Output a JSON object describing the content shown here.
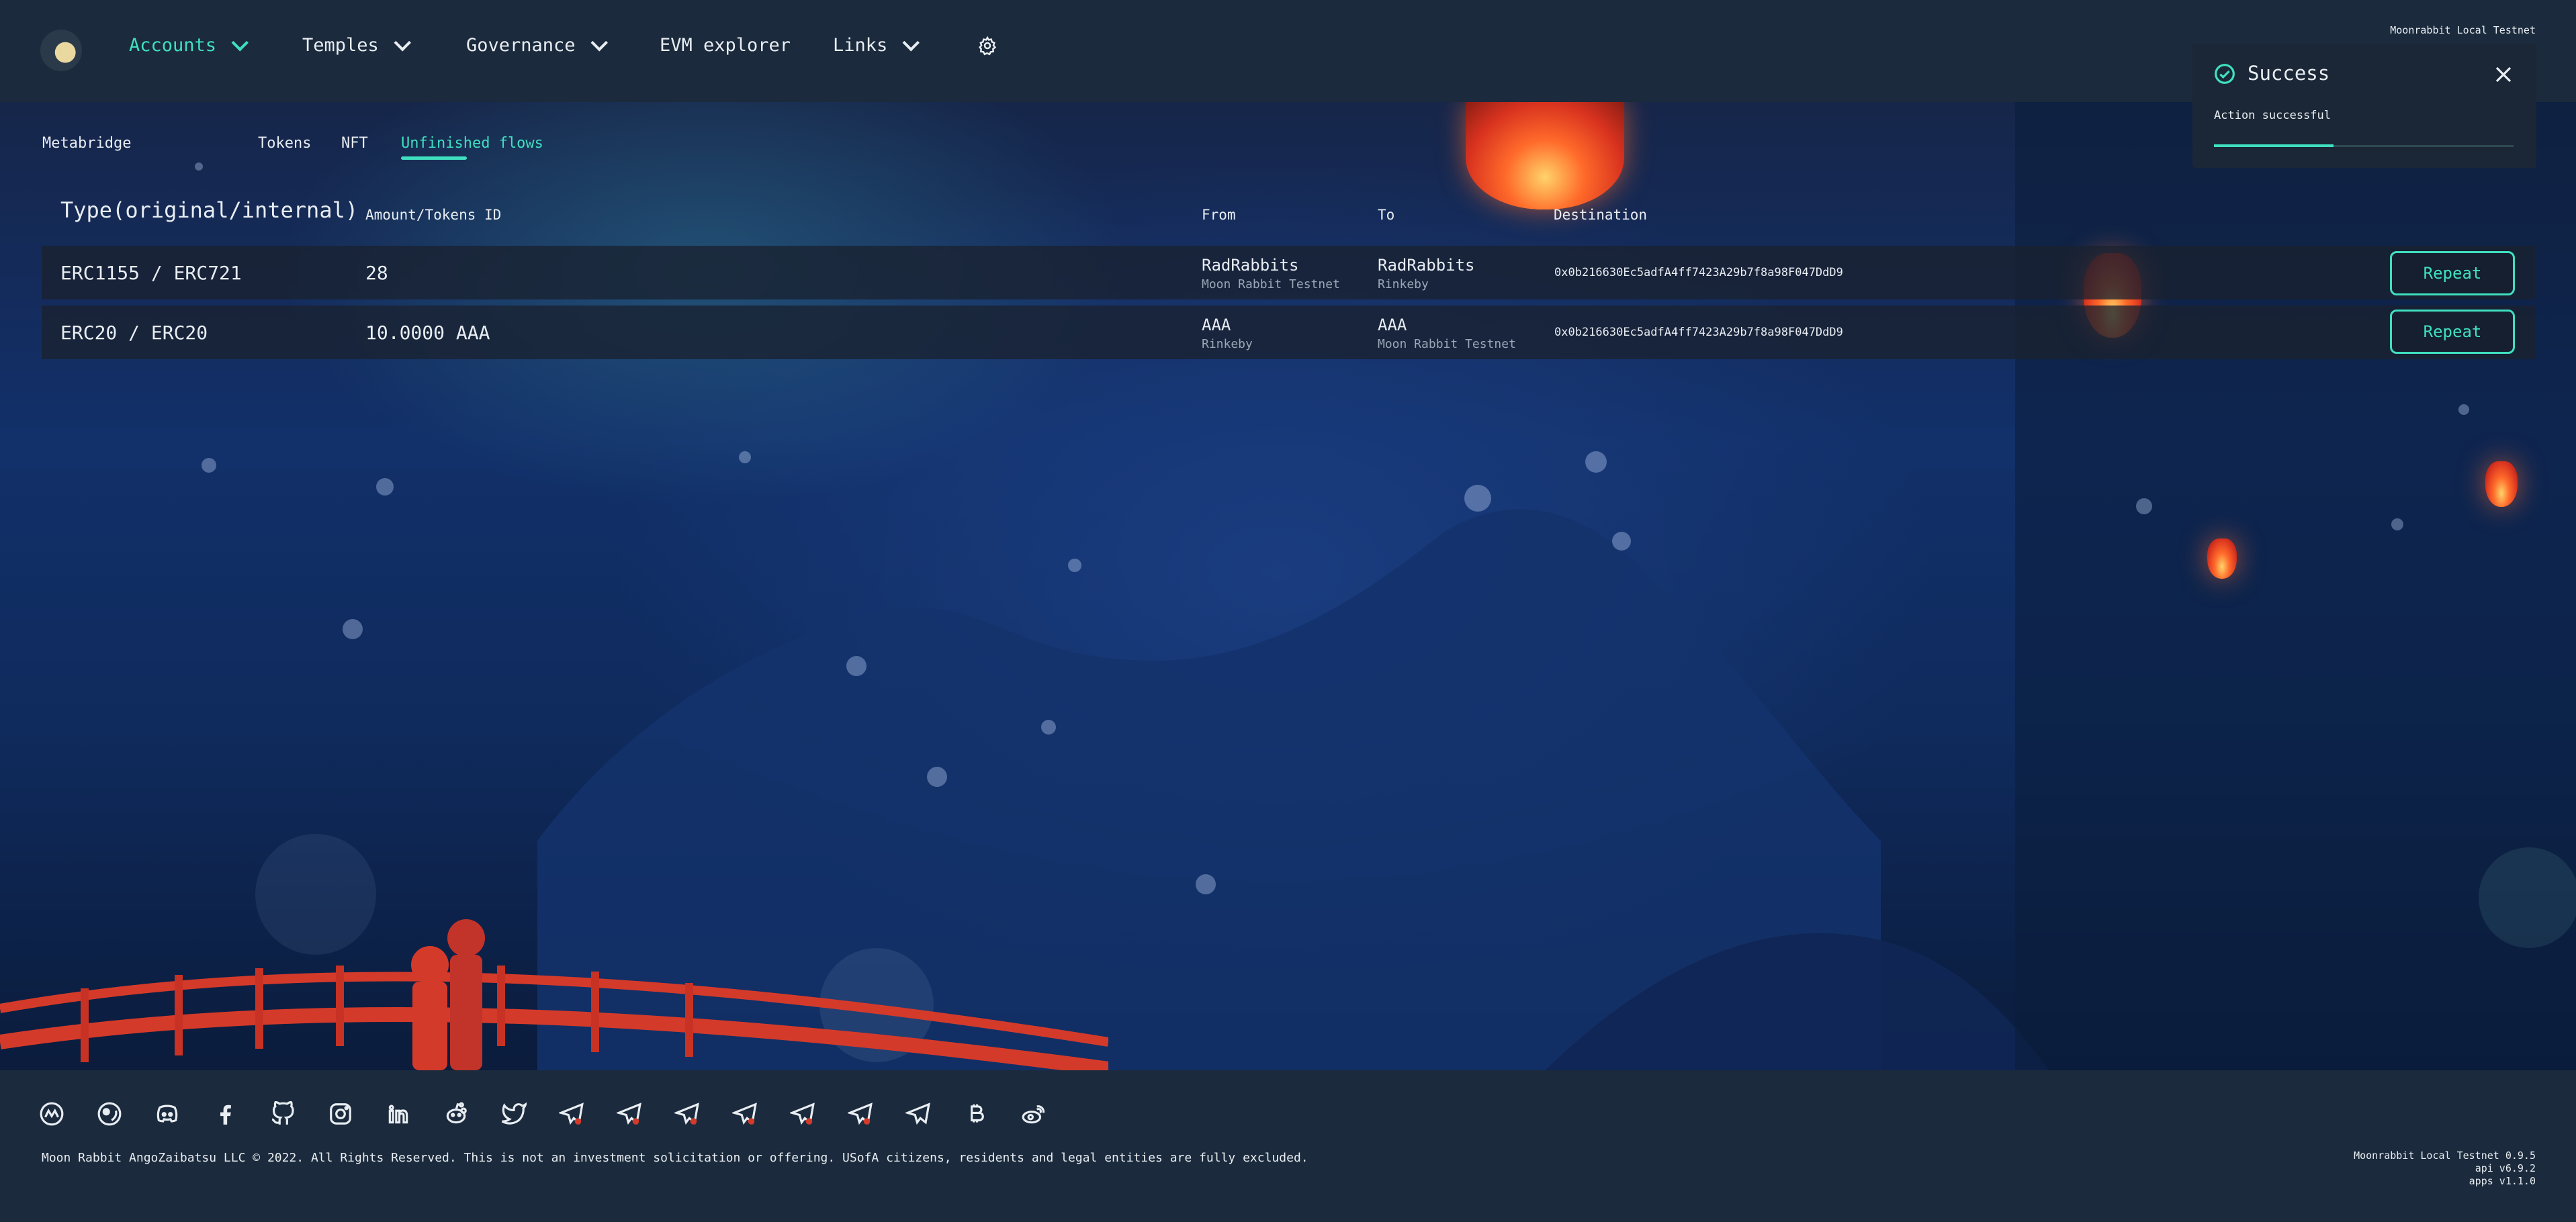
{
  "header": {
    "network_label": "Moonrabbit Local Testnet",
    "nav": [
      {
        "label": "Accounts",
        "has_dropdown": true,
        "active": true
      },
      {
        "label": "Temples",
        "has_dropdown": true
      },
      {
        "label": "Governance",
        "has_dropdown": true
      },
      {
        "label": "EVM explorer",
        "has_dropdown": false
      },
      {
        "label": "Links",
        "has_dropdown": true
      }
    ],
    "settings_icon": "gear-icon",
    "logo_icon": "moon-rabbit-logo-icon"
  },
  "subnav": {
    "section": "Metabridge",
    "tabs": [
      {
        "label": "Tokens"
      },
      {
        "label": "NFT"
      },
      {
        "label": "Unfinished flows",
        "active": true
      }
    ]
  },
  "table": {
    "headers": {
      "type": "Type(original/internal)",
      "amount": "Amount/Tokens ID",
      "from": "From",
      "to": "To",
      "destination": "Destination"
    },
    "rows": [
      {
        "type": "ERC1155 / ERC721",
        "amount": "28",
        "from_name": "RadRabbits",
        "from_network": "Moon Rabbit Testnet",
        "to_name": "RadRabbits",
        "to_network": "Rinkeby",
        "destination": "0x0b216630Ec5adfA4ff7423A29b7f8a98F047DdD9",
        "action": "Repeat"
      },
      {
        "type": "ERC20 / ERC20",
        "amount": "10.0000 AAA",
        "from_name": "AAA",
        "from_network": "Rinkeby",
        "to_name": "AAA",
        "to_network": "Moon Rabbit Testnet",
        "destination": "0x0b216630Ec5adfA4ff7423A29b7f8a98F047DdD9",
        "action": "Repeat"
      }
    ]
  },
  "toast": {
    "title": "Success",
    "message": "Action successful",
    "progress": 0.4,
    "icon": "check-circle-icon",
    "close_icon": "close-icon"
  },
  "footer": {
    "social_icons": [
      "moonrabbit-icon",
      "coingecko-icon",
      "discord-icon",
      "facebook-icon",
      "github-icon",
      "instagram-icon",
      "linkedin-icon",
      "reddit-icon",
      "twitter-icon",
      "telegram-icon",
      "telegram-icon",
      "telegram-icon",
      "telegram-icon",
      "telegram-icon",
      "telegram-icon",
      "telegram-icon",
      "bitcoin-icon",
      "weibo-icon"
    ],
    "copyright": "Moon Rabbit AngoZaibatsu LLC © 2022. All Rights Reserved. This is not an investment solicitation or offering. USofA citizens, residents and legal entities are fully excluded.",
    "versions": [
      "Moonrabbit Local Testnet 0.9.5",
      "api v6.9.2",
      "apps v1.1.0"
    ]
  },
  "colors": {
    "accent": "#3fe0c0",
    "header_bg": "#1b2a3c",
    "row_bg": "#192130",
    "text": "#e8edf2",
    "muted": "#9aa7b6"
  }
}
